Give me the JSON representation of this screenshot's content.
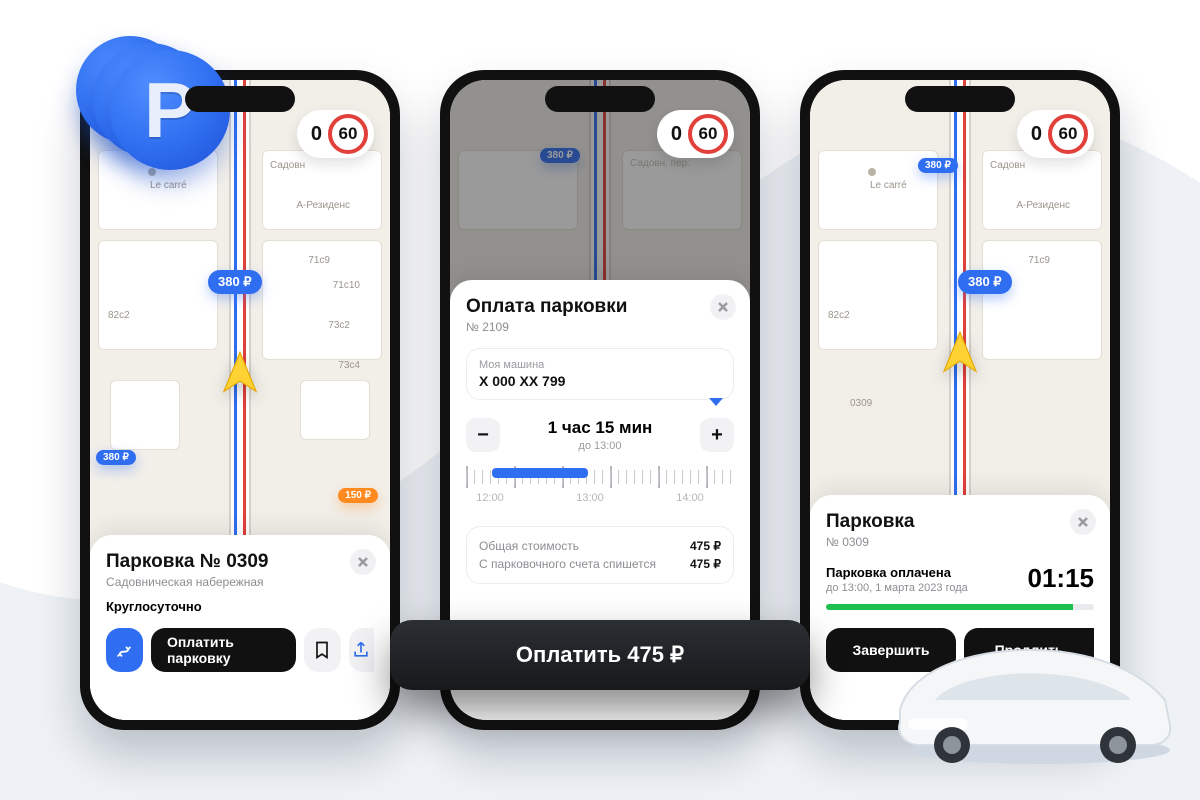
{
  "brand_accent": "#2f6ef0",
  "speed": {
    "current": "0",
    "limit": "60"
  },
  "map_price_main": "380 ₽",
  "map_price_small_a": "380 ₽",
  "map_price_small_b": "150 ₽",
  "map_price_small_c": "380 ₽",
  "map_labels": {
    "street": "Садовн",
    "poi": "Le carré",
    "residence": "А-Резиденс",
    "h71c9": "71с9",
    "h71c10": "71с10",
    "h82c2": "82с2",
    "h73c2": "73c2",
    "h73c4": "73c4",
    "h0309": "0309"
  },
  "screen1": {
    "title": "Парковка № 0309",
    "address": "Садовническая набережная",
    "hours": "Круглосуточно",
    "pay_button": "Оплатить парковку"
  },
  "screen2": {
    "title": "Оплата парковки",
    "number": "№ 2109",
    "car_label": "Моя машина",
    "car_plate": "X 000 XX 799",
    "duration_main": "1 час 15 мин",
    "duration_sub": "до 13:00",
    "time_ticks": [
      "12:00",
      "13:00",
      "14:00"
    ],
    "total_label": "Общая стоимость",
    "total_value": "475 ₽",
    "account_label": "С парковочного счета спишется",
    "account_value": "475 ₽",
    "pay_button": "Оплатить 475 ₽"
  },
  "screen3": {
    "title": "Парковка",
    "number": "№ 0309",
    "paid_label": "Парковка оплачена",
    "until": "до 13:00, 1 марта 2023 года",
    "timer": "01:15",
    "progress_pct": 92,
    "finish_button": "Завершить",
    "extend_button": "Продлить"
  }
}
